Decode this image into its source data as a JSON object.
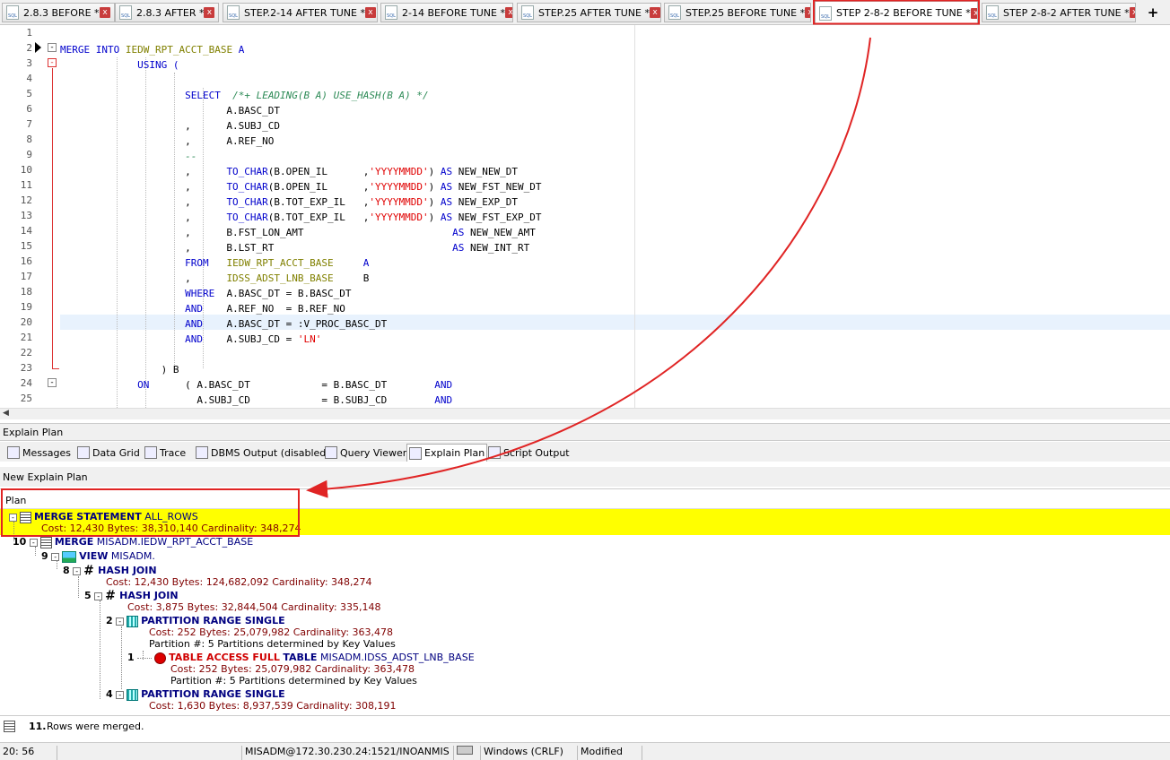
{
  "tabs": [
    {
      "label": "2.8.3 BEFORE *"
    },
    {
      "label": "2.8.3 AFTER *"
    },
    {
      "label": "STEP.2-14 AFTER TUNE *"
    },
    {
      "label": "2-14 BEFORE TUNE *"
    },
    {
      "label": "STEP.25 AFTER TUNE *"
    },
    {
      "label": "STEP.25 BEFORE TUNE *"
    },
    {
      "label": "STEP 2-8-2 BEFORE TUNE *"
    },
    {
      "label": "STEP 2-8-2 AFTER TUNE *"
    }
  ],
  "sql_icon_text": "SQL",
  "close_glyph": "x",
  "add_tab_glyph": "+",
  "editor": {
    "line_numbers": [
      "1",
      "2",
      "3",
      "4",
      "5",
      "6",
      "7",
      "8",
      "9",
      "10",
      "11",
      "12",
      "13",
      "14",
      "15",
      "16",
      "17",
      "18",
      "19",
      "20",
      "21",
      "22",
      "23",
      "24",
      "25"
    ]
  },
  "panel_title": "Explain Plan",
  "bottom_tabs": [
    "Messages",
    "Data Grid",
    "Trace",
    "DBMS Output (disabled)",
    "Query Viewer",
    "Explain Plan",
    "Script Output"
  ],
  "new_explain_label": "New Explain Plan",
  "plan": {
    "column_header": "Plan",
    "nodes": [
      {
        "id": "",
        "name": "MERGE STATEMENT",
        "extra": "ALL_ROWS",
        "details": "Cost: 12,430  Bytes: 38,310,140  Cardinality: 348,274"
      },
      {
        "id": "10",
        "name": "MERGE",
        "extra": "MISADM.IEDW_RPT_ACCT_BASE",
        "details": ""
      },
      {
        "id": "9",
        "name": "VIEW",
        "extra": "MISADM.",
        "details": ""
      },
      {
        "id": "8",
        "name": "HASH JOIN",
        "extra": "",
        "details": "Cost: 12,430  Bytes: 124,682,092  Cardinality: 348,274"
      },
      {
        "id": "5",
        "name": "HASH JOIN",
        "extra": "",
        "details": "Cost: 3,875  Bytes: 32,844,504  Cardinality: 335,148"
      },
      {
        "id": "2",
        "name": "PARTITION RANGE SINGLE",
        "extra": "",
        "details": "Cost: 252  Bytes: 25,079,982  Cardinality: 363,478",
        "details2": "Partition #: 5  Partitions determined by Key Values"
      },
      {
        "id": "1",
        "name": "TABLE ACCESS FULL",
        "name2": "TABLE",
        "extra": "MISADM.IDSS_ADST_LNB_BASE",
        "details": "Cost: 252  Bytes: 25,079,982  Cardinality: 363,478",
        "details2": "Partition #: 5  Partitions determined by Key Values"
      },
      {
        "id": "4",
        "name": "PARTITION RANGE SINGLE",
        "extra": "",
        "details": "Cost: 1,630  Bytes: 8,937,539  Cardinality: 308,191"
      }
    ]
  },
  "message": {
    "number": "11.",
    "text": "Rows were merged."
  },
  "status": {
    "position": "20:  56",
    "connection": "MISADM@172.30.230.24:1521/INOANMIS",
    "line_ending": "Windows (CRLF)",
    "state": "Modified"
  },
  "colors": {
    "annotation_red": "#e02424",
    "highlight_yellow": "#ffff00",
    "keyword_blue": "#0000cc",
    "string_red": "#e00000",
    "object_olive": "#808000",
    "comment_green": "#2e8b57"
  }
}
